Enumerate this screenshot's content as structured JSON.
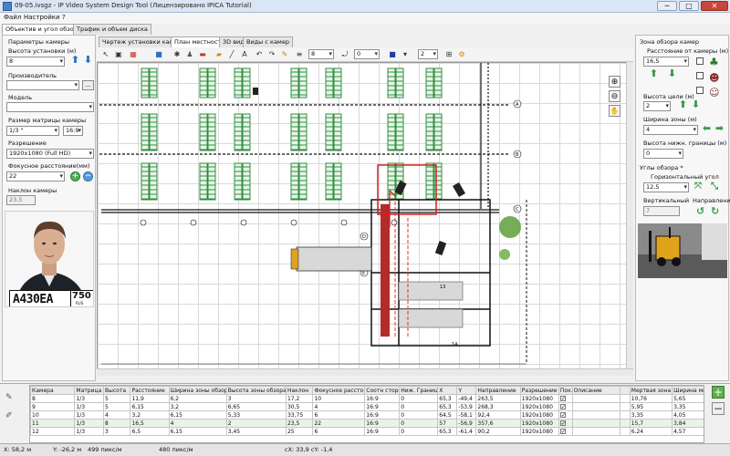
{
  "window": {
    "title": "09-05.ivsgz - IP Video System Design Tool (Лицензировано IPICA Tutorial)",
    "min_label": "─",
    "max_label": "□",
    "close_label": "✕"
  },
  "menu": {
    "file": "Файл",
    "settings": "Настройки",
    "help": "?"
  },
  "left_tabs": {
    "camera": "Объектив и угол обзора",
    "traffic": "Трафик и объем диска"
  },
  "left_panel": {
    "camera_params": "Параметры камеры",
    "mount_height_label": "Высота установки (м)",
    "mount_height_value": "8",
    "manufacturer_label": "Производитель",
    "manufacturer_value": "",
    "browse_label": "...",
    "model_label": "Модель",
    "model_value": "",
    "sensor_label": "Размер матрицы камеры",
    "sensor_value": "1/3 \"",
    "aspect_value": "16:9",
    "resolution_label": "Разрешение",
    "resolution_value": "1920x1080 (Full HD)",
    "focal_label": "Фокусное расстояние(мм)",
    "focal_value": "22",
    "tilt_label": "Наклон камеры",
    "tilt_value": "23,5",
    "plate_text": "A430EA",
    "plate_region": "750",
    "plate_country": "RUS"
  },
  "map_tabs": [
    "Чертеж установки камеры",
    "План местности",
    "3D вид",
    "Виды с камер"
  ],
  "toolbar": {
    "num1": "8",
    "num2": "0",
    "num3": "2"
  },
  "map_labels": {
    "row_a": "A",
    "row_b": "B",
    "row_c": "C",
    "row_d": "D",
    "row_e": "E",
    "num_13": "13",
    "num_14": "14"
  },
  "right_panel": {
    "zone_title": "Зона обзора камер",
    "distance_label": "Расстояние от камеры (м)",
    "distance_value": "16,5",
    "target_height_label": "Высота цели (м)",
    "target_height_value": "2",
    "zone_width_label": "Ширина зоны (м)",
    "zone_width_value": "4",
    "lower_bound_label": "Высота нижн. границы (м)",
    "lower_bound_value": "0",
    "angles_title": "Углы обзора *",
    "horizontal_label": "Горизонтальный угол",
    "horizontal_value": "12,5",
    "vertical_label": "Вертикальный",
    "vertical_value": "7",
    "direction_label": "Направление"
  },
  "table": {
    "headers": [
      "Камера",
      "Матрица",
      "Высота",
      "Расстояние",
      "Ширина зоны обзора",
      "Высота зоны обзора",
      "Наклон",
      "Фокусное расстояние",
      "Соотн сторон",
      "Ниж. Граница",
      "X",
      "Y",
      "Направление",
      "Разрешение",
      "Пок.",
      "Описание",
      "",
      "Мертвая зона",
      "Ширина мн"
    ],
    "rows": [
      [
        "8",
        "1/3",
        "5",
        "11,9",
        "6,2",
        "3",
        "17,2",
        "10",
        "16:9",
        "0",
        "65,3",
        "-49,4",
        "263,5",
        "1920x1080",
        "✓",
        "",
        "",
        "10,76",
        "5,65"
      ],
      [
        "9",
        "1/3",
        "5",
        "6,15",
        "3,2",
        "6,65",
        "30,5",
        "4",
        "16:9",
        "0",
        "65,3",
        "-53,9",
        "268,3",
        "1920x1080",
        "✓",
        "",
        "",
        "5,95",
        "3,35"
      ],
      [
        "10",
        "1/3",
        "4",
        "3,2",
        "6,15",
        "5,33",
        "33,75",
        "6",
        "16:9",
        "0",
        "64,5",
        "-58,1",
        "92,4",
        "1920x1080",
        "✓",
        "",
        "",
        "3,35",
        "4,05"
      ],
      [
        "11",
        "1/3",
        "8",
        "16,5",
        "4",
        "2",
        "23,5",
        "22",
        "16:9",
        "0",
        "57",
        "-56,9",
        "357,6",
        "1920x1080",
        "✓",
        "",
        "",
        "15,7",
        "3,84"
      ],
      [
        "12",
        "1/3",
        "3",
        "6,5",
        "6,15",
        "3,45",
        "25",
        "6",
        "16:9",
        "0",
        "65,3",
        "-61,4",
        "90,2",
        "1920x1080",
        "✓",
        "",
        "",
        "6,24",
        "4,57"
      ]
    ]
  },
  "status": {
    "x": "X: 58,2 м",
    "y": "Y: -26,2 м",
    "pps": "499 пикс/м",
    "pps2": "480 пикс/м",
    "cxy": "cX: 33,9  cY: -1,4"
  }
}
